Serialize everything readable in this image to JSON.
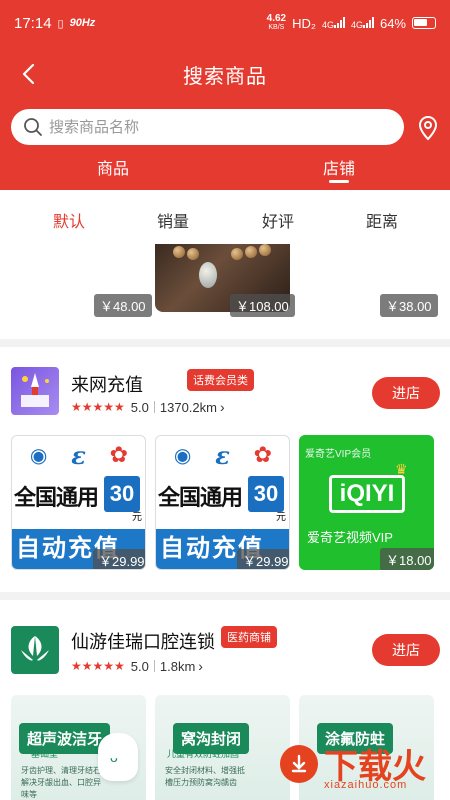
{
  "status_bar": {
    "time": "17:14",
    "refresh_rate": "90Hz",
    "net_speed": "4.62",
    "net_unit": "KB/S",
    "hd": "HD₂",
    "net1": "4G",
    "net2": "4G",
    "battery": "64%"
  },
  "nav": {
    "title": "搜索商品"
  },
  "search": {
    "placeholder": "搜索商品名称"
  },
  "tabs": [
    {
      "label": "商品",
      "active": false
    },
    {
      "label": "店铺",
      "active": true
    }
  ],
  "sort_options": [
    {
      "label": "默认",
      "active": true
    },
    {
      "label": "销量",
      "active": false
    },
    {
      "label": "好评",
      "active": false
    },
    {
      "label": "距离",
      "active": false
    }
  ],
  "prev_prices": [
    "￥48.00",
    "￥108.00",
    "￥38.00"
  ],
  "shops": [
    {
      "name": "来网充值",
      "badge": "话费会员类",
      "rating": "5.0",
      "distance": "1370.2km",
      "enter_label": "进店",
      "products": [
        {
          "type": "telecom",
          "headline": "全国通用",
          "amount": "30",
          "unit": "元",
          "footer": "自动充值",
          "price": "￥29.99"
        },
        {
          "type": "telecom",
          "headline": "全国通用",
          "amount": "30",
          "unit": "元",
          "footer": "自动充值",
          "price": "￥29.99"
        },
        {
          "type": "iqiyi",
          "top_line": "爱奇艺VIP会员",
          "logo": "iQIYI",
          "caption": "爱奇艺视频VIP",
          "price": "￥18.00"
        }
      ]
    },
    {
      "name": "仙游佳瑞口腔连锁",
      "badge": "医药商铺",
      "rating": "5.0",
      "distance": "1.8km",
      "enter_label": "进店",
      "products": [
        {
          "head": "超声波洁牙",
          "sub": "基础型",
          "body": "牙齿护理、清理牙结石 解决牙龈出血、口腔异味等"
        },
        {
          "head": "窝沟封闭",
          "sub": "儿童有效防蛀加固",
          "body": "安全封闭材料、增强抵 槽压力预防窝沟龋齿"
        },
        {
          "head": "涂氟防蛀",
          "sub": "",
          "body": ""
        }
      ]
    }
  ],
  "watermark": {
    "brand": "下载火",
    "domain": "xiazaihuo.com"
  },
  "colors": {
    "primary": "#e53a2f",
    "telecom_blue": "#1a6fc0",
    "iqiyi_green": "#1fbf2e",
    "dental_green": "#1a8a5a"
  },
  "icons": [
    "back-arrow-icon",
    "search-icon",
    "location-pin-icon",
    "star-icon",
    "chevron-right-icon"
  ]
}
